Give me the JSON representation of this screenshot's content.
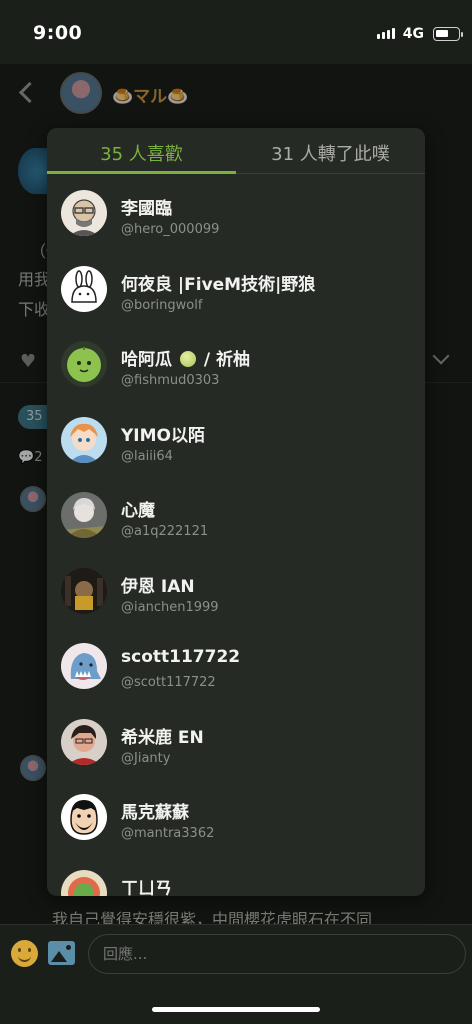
{
  "status_bar": {
    "time": "9:00",
    "network": "4G"
  },
  "header": {
    "name": "🍮マル🍮"
  },
  "background": {
    "tag_count": "35",
    "comment_count": "2",
    "text_line_1": "（僅",
    "text_line_2": "用我",
    "text_line_3": "下收",
    "bottom_text": "我自己覺得安穩很紫，中間櫻花虎眼石在不同"
  },
  "popup": {
    "tabs": [
      {
        "label": "35 人喜歡",
        "active": true
      },
      {
        "label": "31 人轉了此噗",
        "active": false
      }
    ],
    "users": [
      {
        "name": "李國臨",
        "handle": "@hero_000099",
        "avatar_color": "#e9e4dc"
      },
      {
        "name": "何夜良 |FiveM技術|野狼",
        "handle": "@boringwolf",
        "avatar_color": "#ffffff"
      },
      {
        "name_pre": "哈阿瓜 ",
        "name_post": " / 祈柚",
        "handle": "@fishmud0303",
        "avatar_color": "#8dc24f"
      },
      {
        "name": "YIMO以陌",
        "handle": "@laiii64",
        "avatar_color": "#7fb4d6"
      },
      {
        "name": "心魔",
        "handle": "@a1q222121",
        "avatar_color": "#8a8c88"
      },
      {
        "name": "伊恩 IAN",
        "handle": "@ianchen1999",
        "avatar_color": "#2b2620"
      },
      {
        "name": "scott117722",
        "handle": "@scott117722",
        "avatar_color": "#e4dfe2"
      },
      {
        "name": "希米鹿 EN",
        "handle": "@Jianty",
        "avatar_color": "#c47a6a"
      },
      {
        "name": "馬克蘇蘇",
        "handle": "@mantra3362",
        "avatar_color": "#ffffff"
      },
      {
        "name": "ㄒㄩㄢ",
        "handle": "",
        "avatar_color": "#d8c48a"
      }
    ]
  },
  "reply": {
    "placeholder": "回應..."
  },
  "colors": {
    "accent": "#7bb13f",
    "background": "#1b1f19",
    "popup": "#262a24"
  }
}
